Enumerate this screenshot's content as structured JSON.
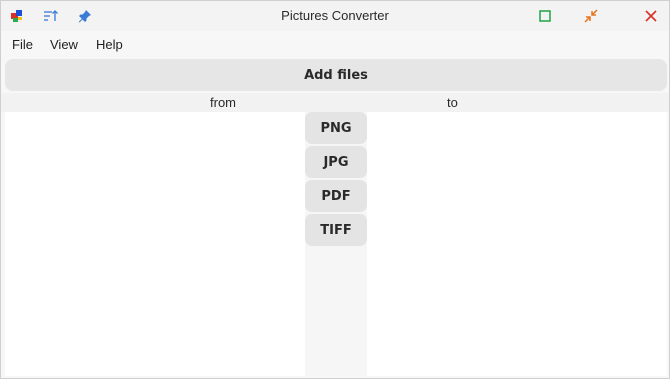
{
  "window": {
    "title": "Pictures Converter"
  },
  "titlebar": {
    "left_icons": [
      "app-icon",
      "sort-icon",
      "pin-icon"
    ],
    "right_icons": [
      "maximize-icon",
      "restore-icon",
      "close-icon"
    ]
  },
  "menu": {
    "items": [
      "File",
      "View",
      "Help"
    ]
  },
  "toolbar": {
    "add_files_label": "Add files"
  },
  "columns": {
    "from_label": "from",
    "to_label": "to"
  },
  "formats": [
    "PNG",
    "JPG",
    "PDF",
    "TIFF"
  ],
  "colors": {
    "maximize": "#2fa84f",
    "restore": "#e8731a",
    "close": "#d93025",
    "sort": "#3a7bd5",
    "pin": "#3a7bd5"
  }
}
